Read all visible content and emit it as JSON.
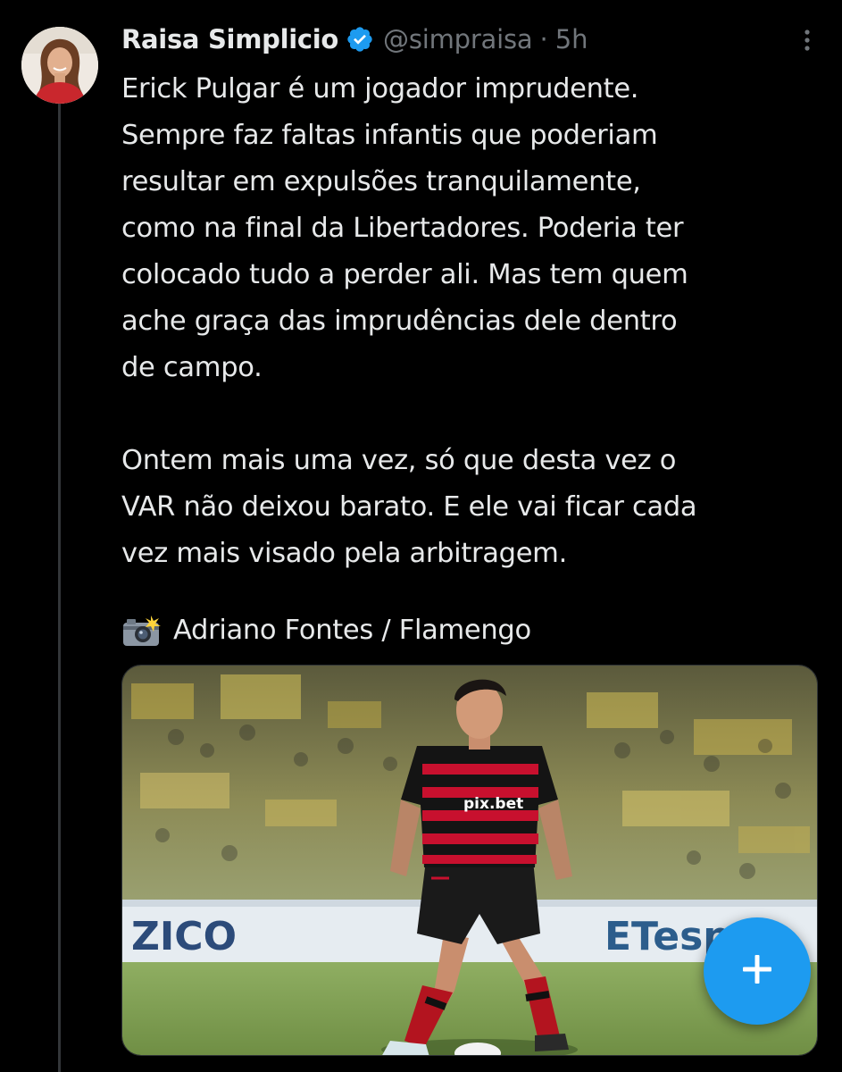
{
  "tweet": {
    "author_name": "Raisa Simplicio",
    "handle": "@simpraisa",
    "separator": "·",
    "time": "5h",
    "text": "Erick Pulgar é um jogador imprudente.\nSempre faz faltas infantis que poderiam\nresultar em expulsões tranquilamente,\ncomo na final da Libertadores. Poderia ter\ncolocado tudo a perder ali. Mas tem quem\nache graça das imprudências dele dentro\nde campo.\n\nOntem mais uma vez, só que desta vez o\nVAR não deixou barato. E ele vai ficar cada\nvez mais visado pela arbitragem.",
    "photo_credit": "Adriano Fontes / Flamengo",
    "camera_emoji": "camera-with-flash-icon",
    "media": {
      "jersey_sponsor": "pix.bet",
      "board_text_left": "ZICO",
      "board_text_right": "ETesp"
    }
  },
  "icons": {
    "verified": "verified-badge-icon",
    "more": "more-options-icon",
    "compose": "plus-icon"
  },
  "colors": {
    "background": "#000000",
    "text_primary": "#e7e9ea",
    "text_secondary": "#71767b",
    "accent": "#1d9bf0",
    "thread_line": "#333639"
  }
}
